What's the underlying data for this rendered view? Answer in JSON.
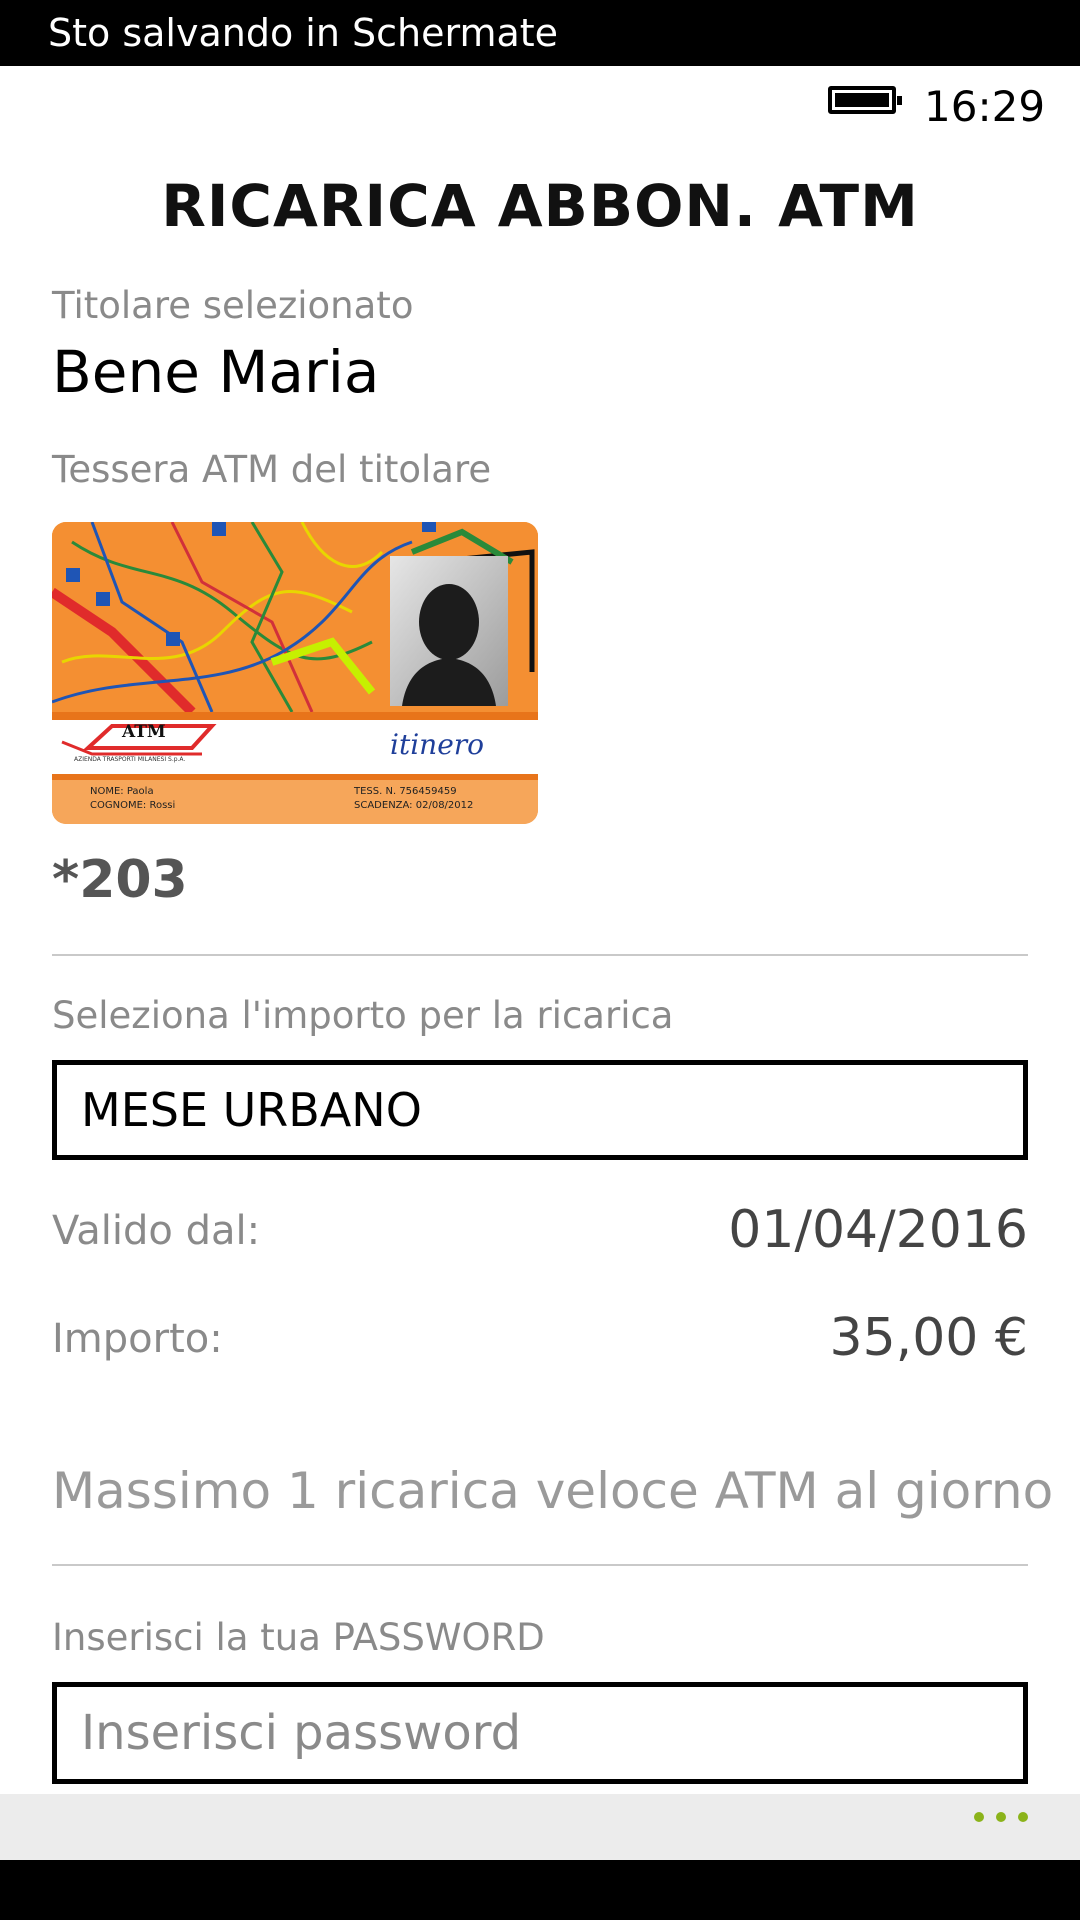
{
  "notification": {
    "text": "Sto salvando in Schermate"
  },
  "status_bar": {
    "time": "16:29",
    "battery_icon": "battery-full-icon"
  },
  "header": {
    "title": "RICARICA ABBON. ATM"
  },
  "holder": {
    "label": "Titolare selezionato",
    "name": "Bene Maria"
  },
  "card": {
    "label": "Tessera ATM del titolare",
    "brand": "ATM",
    "brand_sub": "AZIENDA TRASPORTI MILANESI S.p.A.",
    "product": "itinero",
    "line1_left": "NOME: Paola",
    "line2_left": "COGNOME: Rossi",
    "line1_right": "TESS. N. 756459459",
    "line2_right": "SCADENZA: 02/08/2012",
    "number": "*203"
  },
  "amount": {
    "label": "Seleziona l'importo per la ricarica",
    "selected": "MESE URBANO",
    "valid_label": "Valido dal:",
    "valid_value": "01/04/2016",
    "price_label": "Importo:",
    "price_value": "35,00 €",
    "note": "Massimo 1 ricarica veloce ATM al giorno"
  },
  "password": {
    "label": "Inserisci la tua PASSWORD",
    "placeholder": "Inserisci password"
  },
  "colors": {
    "accent_dots": "#8bb31a",
    "card_orange": "#f39a3c",
    "card_red": "#e02b2b"
  }
}
